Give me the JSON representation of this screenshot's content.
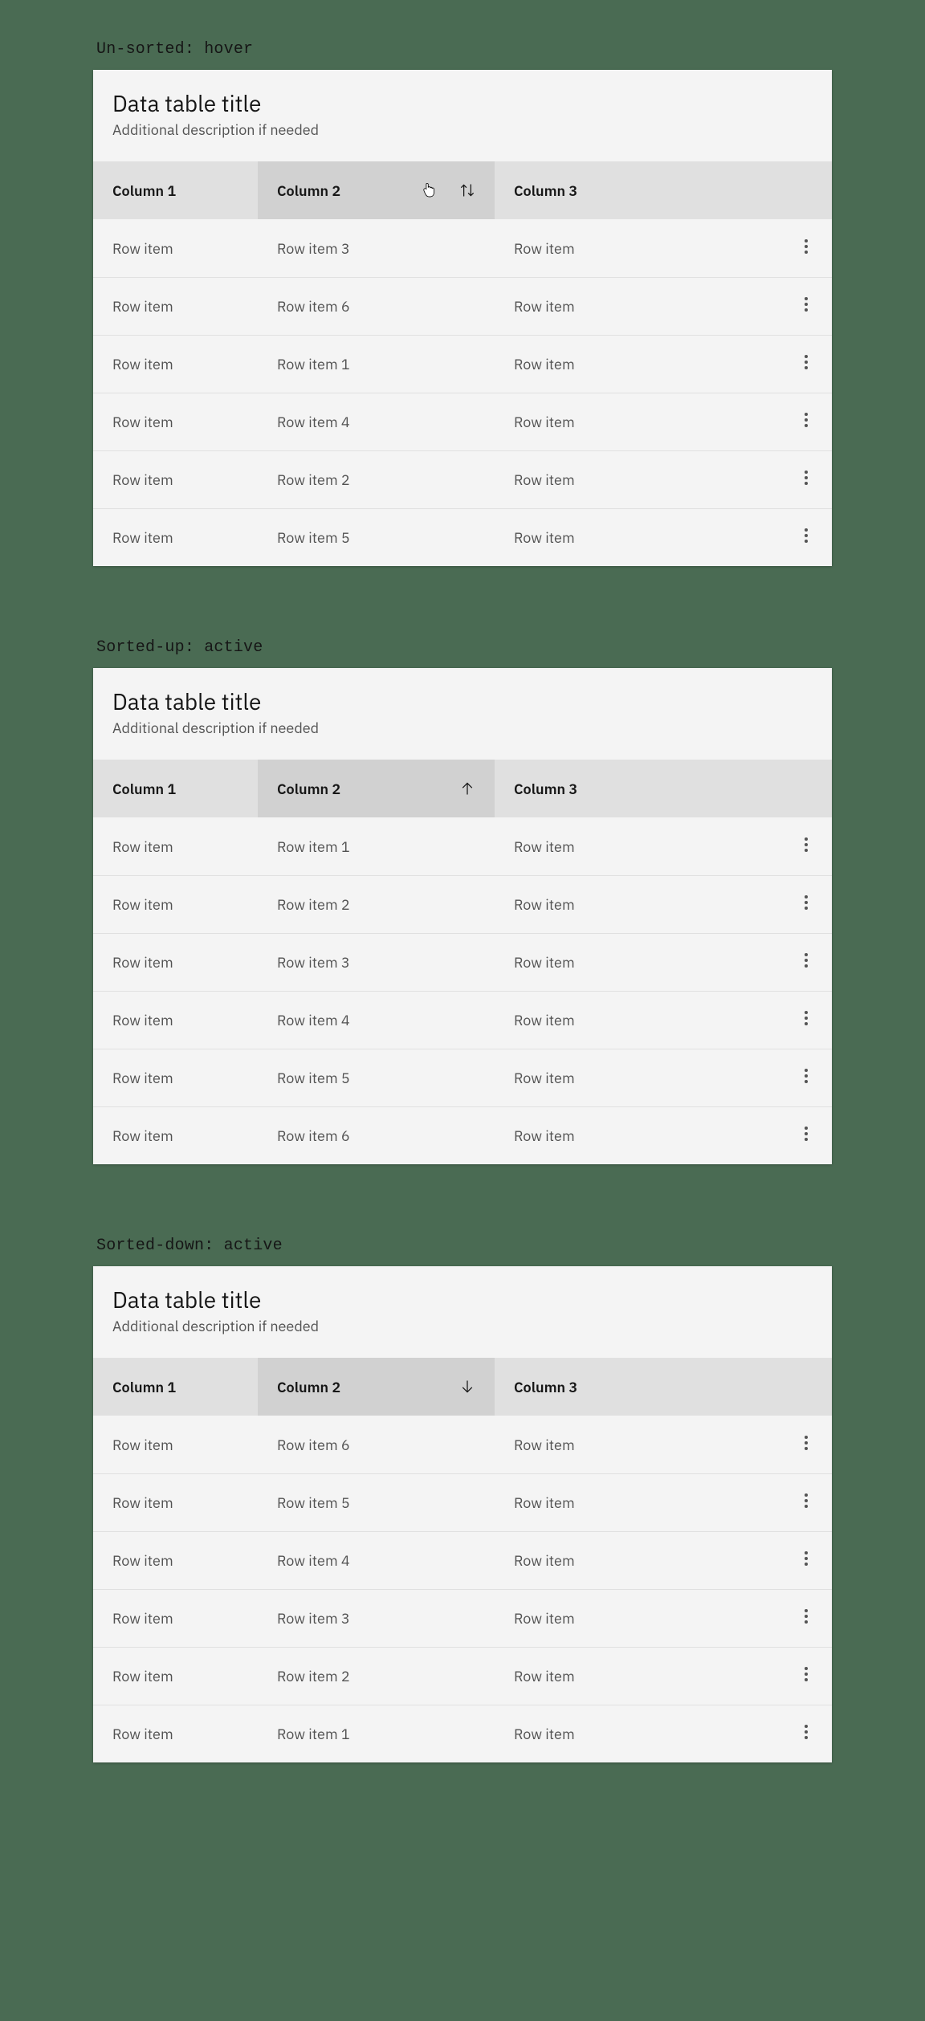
{
  "common": {
    "title": "Data table title",
    "description": "Additional description if needed",
    "columns": [
      "Column 1",
      "Column 2",
      "Column 3"
    ]
  },
  "sections": [
    {
      "label": "Un-sorted: hover",
      "sort_state": "none",
      "show_cursor": true,
      "rows": [
        {
          "c1": "Row item",
          "c2": "Row item 3",
          "c3": "Row item"
        },
        {
          "c1": "Row item",
          "c2": "Row item 6",
          "c3": "Row item"
        },
        {
          "c1": "Row item",
          "c2": "Row item 1",
          "c3": "Row item"
        },
        {
          "c1": "Row item",
          "c2": "Row item 4",
          "c3": "Row item"
        },
        {
          "c1": "Row item",
          "c2": "Row item 2",
          "c3": "Row item"
        },
        {
          "c1": "Row item",
          "c2": "Row item 5",
          "c3": "Row item"
        }
      ]
    },
    {
      "label": "Sorted-up: active",
      "sort_state": "up",
      "show_cursor": false,
      "rows": [
        {
          "c1": "Row item",
          "c2": "Row item 1",
          "c3": "Row item"
        },
        {
          "c1": "Row item",
          "c2": "Row item 2",
          "c3": "Row item"
        },
        {
          "c1": "Row item",
          "c2": "Row item 3",
          "c3": "Row item"
        },
        {
          "c1": "Row item",
          "c2": "Row item 4",
          "c3": "Row item"
        },
        {
          "c1": "Row item",
          "c2": "Row item 5",
          "c3": "Row item"
        },
        {
          "c1": "Row item",
          "c2": "Row item 6",
          "c3": "Row item"
        }
      ]
    },
    {
      "label": "Sorted-down: active",
      "sort_state": "down",
      "show_cursor": false,
      "rows": [
        {
          "c1": "Row item",
          "c2": "Row item 6",
          "c3": "Row item"
        },
        {
          "c1": "Row item",
          "c2": "Row item 5",
          "c3": "Row item"
        },
        {
          "c1": "Row item",
          "c2": "Row item 4",
          "c3": "Row item"
        },
        {
          "c1": "Row item",
          "c2": "Row item 3",
          "c3": "Row item"
        },
        {
          "c1": "Row item",
          "c2": "Row item 2",
          "c3": "Row item"
        },
        {
          "c1": "Row item",
          "c2": "Row item 1",
          "c3": "Row item"
        }
      ]
    }
  ]
}
